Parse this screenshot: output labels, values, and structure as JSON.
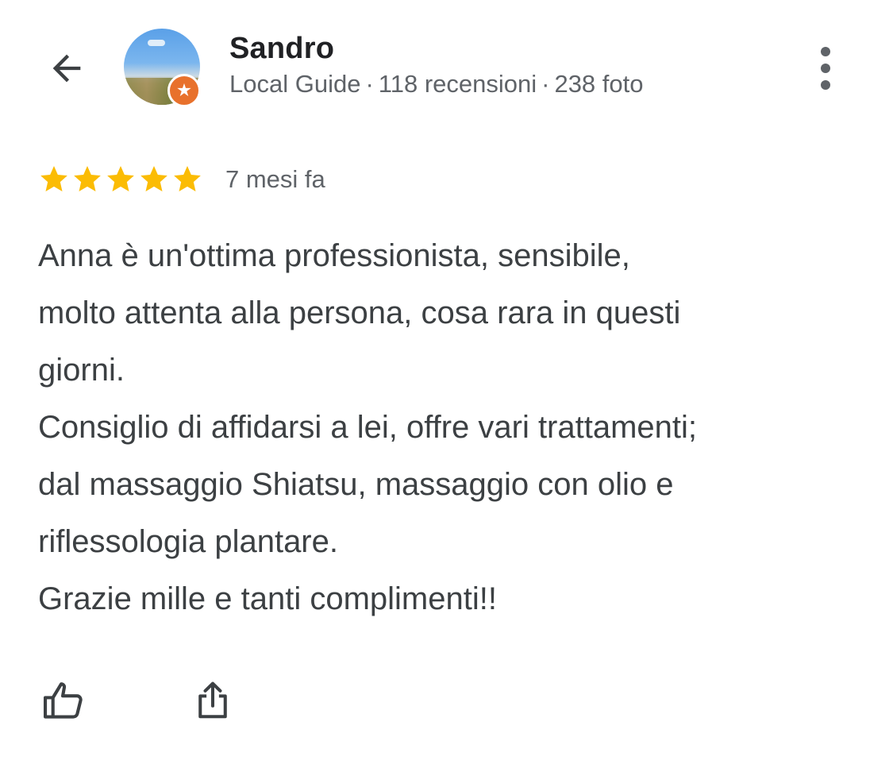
{
  "reviewer": {
    "name": "Sandro",
    "badge": "Local Guide",
    "separator": "·",
    "reviews_count": "118 recensioni",
    "photos_count": "238 foto"
  },
  "review": {
    "rating": 5,
    "max_rating": 5,
    "date": "7 mesi fa",
    "lines": [
      "Anna è un'ottima professionista, sensibile,",
      "molto attenta alla persona, cosa rara in questi",
      "giorni.",
      "Consiglio di affidarsi a lei, offre vari trattamenti;",
      "dal massaggio Shiatsu, massaggio con olio e",
      "riflessologia plantare.",
      "Grazie mille e tanti complimenti!!"
    ]
  },
  "icons": {
    "back": "arrow-left-icon",
    "more": "more-vertical-icon",
    "star": "star-icon",
    "like": "thumbs-up-icon",
    "share": "share-icon",
    "local_guide_badge": "local-guide-badge-icon"
  },
  "colors": {
    "star": "#FBBC04",
    "badge": "#E8712C",
    "text_primary": "#202124",
    "text_secondary": "#5F6368",
    "text_body": "#3C4043",
    "icon": "#3C4043"
  }
}
